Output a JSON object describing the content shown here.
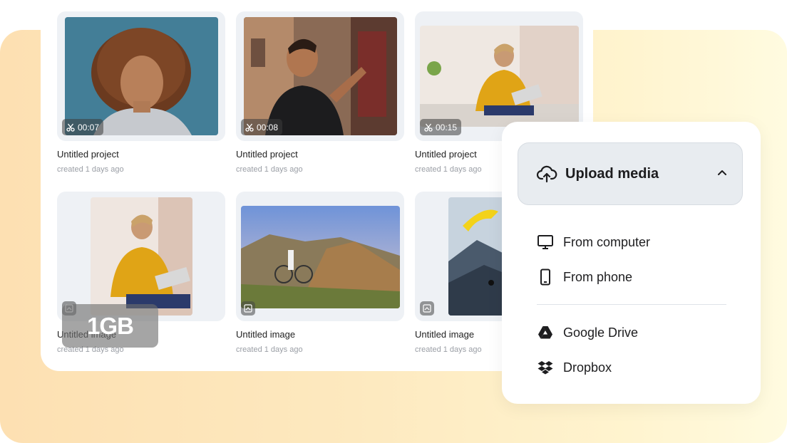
{
  "projects": [
    {
      "title": "Untitled project",
      "subtitle": "created 1 days ago",
      "duration": "00:07",
      "icon": "scissors-icon"
    },
    {
      "title": "Untitled project",
      "subtitle": "created 1 days ago",
      "duration": "00:08",
      "icon": "scissors-icon"
    },
    {
      "title": "Untitled project",
      "subtitle": "created 1 days ago",
      "duration": "00:15",
      "icon": "scissors-icon"
    }
  ],
  "images": [
    {
      "title": "Untitled image",
      "subtitle": "created 1 days ago",
      "icon": "image-icon"
    },
    {
      "title": "Untitled image",
      "subtitle": "created 1 days ago",
      "icon": "image-icon"
    },
    {
      "title": "Untitled image",
      "subtitle": "created 1 days ago",
      "icon": "image-icon"
    }
  ],
  "storage": {
    "label": "1GB"
  },
  "upload": {
    "title": "Upload media",
    "header_icon": "cloud-upload-icon",
    "toggle_icon": "chevron-up-icon",
    "options": [
      {
        "label": "From computer",
        "icon": "monitor-icon"
      },
      {
        "label": "From phone",
        "icon": "phone-icon"
      },
      {
        "label": "Google Drive",
        "icon": "google-drive-icon"
      },
      {
        "label": "Dropbox",
        "icon": "dropbox-icon"
      }
    ]
  },
  "colors": {
    "background_gradient_start": "#fde0b2",
    "background_gradient_end": "#fffbe0",
    "panel_header_bg": "#e8ecf0",
    "text_primary": "#1d1d1f",
    "text_muted": "#9a9ea5"
  }
}
